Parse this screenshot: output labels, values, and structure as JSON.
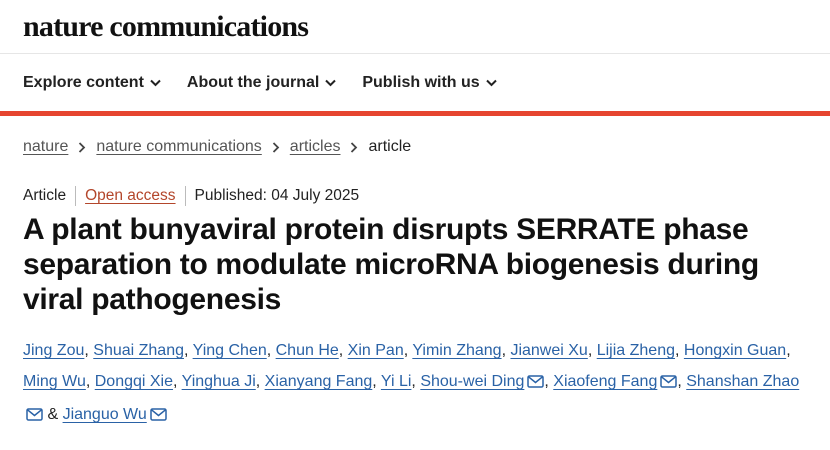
{
  "site": {
    "logo": "nature communications"
  },
  "nav": {
    "items": [
      {
        "label": "Explore content"
      },
      {
        "label": "About the journal"
      },
      {
        "label": "Publish with us"
      }
    ]
  },
  "colors": {
    "accent": "#e6452f",
    "author_link": "#2a62a6",
    "open_access": "#b3462b"
  },
  "icons": {
    "dropdown": "chevron-down-icon",
    "separator": "chevron-right-icon",
    "email": "envelope-icon"
  },
  "breadcrumb": {
    "items": [
      {
        "label": "nature"
      },
      {
        "label": "nature communications"
      },
      {
        "label": "articles"
      }
    ],
    "current": "article"
  },
  "article": {
    "type": "Article",
    "access": "Open access",
    "published": "Published: 04 July 2025",
    "title": "A plant bunyaviral protein disrupts SERRATE phase separation to modulate microRNA biogenesis during viral pathogenesis"
  },
  "authors": {
    "list": [
      {
        "name": "Jing Zou",
        "email": false,
        "after": ", "
      },
      {
        "name": "Shuai Zhang",
        "email": false,
        "after": ", "
      },
      {
        "name": "Ying Chen",
        "email": false,
        "after": ", "
      },
      {
        "name": "Chun He",
        "email": false,
        "after": ", "
      },
      {
        "name": "Xin Pan",
        "email": false,
        "after": ", "
      },
      {
        "name": "Yimin Zhang",
        "email": false,
        "after": ", "
      },
      {
        "name": "Jianwei Xu",
        "email": false,
        "after": ", "
      },
      {
        "name": "Lijia Zheng",
        "email": false,
        "after": ", "
      },
      {
        "name": "Hongxin Guan",
        "email": false,
        "after": ", "
      },
      {
        "name": "Ming Wu",
        "email": false,
        "after": ", "
      },
      {
        "name": "Dongqi Xie",
        "email": false,
        "after": ", "
      },
      {
        "name": "Yinghua Ji",
        "email": false,
        "after": ", "
      },
      {
        "name": "Xianyang Fang",
        "email": false,
        "after": ", "
      },
      {
        "name": "Yi Li",
        "email": false,
        "after": ", "
      },
      {
        "name": "Shou-wei Ding",
        "email": true,
        "after": ", "
      },
      {
        "name": "Xiaofeng Fang",
        "email": true,
        "after": ", "
      },
      {
        "name": "Shanshan Zhao",
        "email": true,
        "after": " & "
      },
      {
        "name": "Jianguo Wu",
        "email": true,
        "after": ""
      }
    ]
  }
}
